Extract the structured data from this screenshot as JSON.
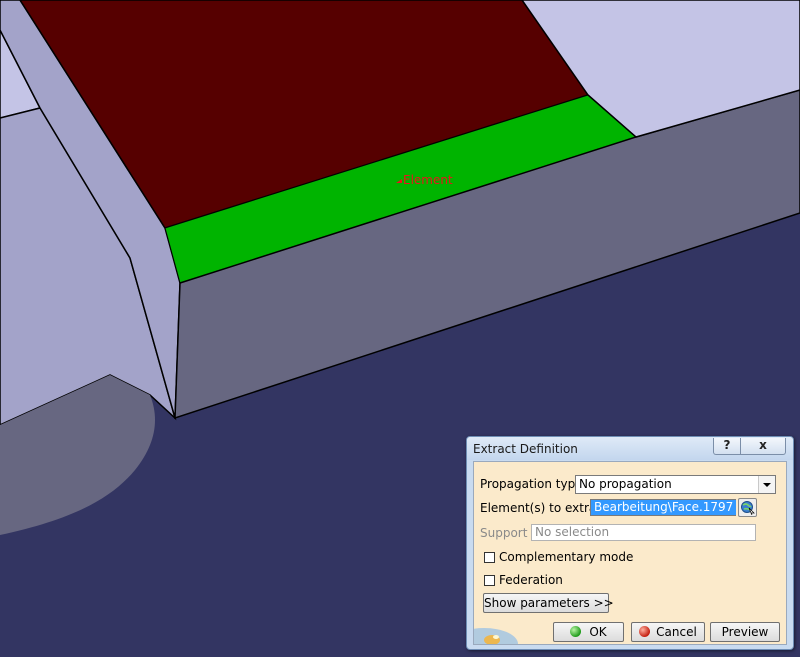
{
  "viewport": {
    "annotation_label": "Element",
    "colors": {
      "background": "#333562",
      "part_face_light": "#c4c4e6",
      "part_face_mid": "#a3a3c9",
      "part_face_dark": "#676781",
      "top_face": "#560000",
      "selected_face": "#00b400",
      "edge": "#000000"
    }
  },
  "dialog": {
    "title": "Extract Definition",
    "help_label": "?",
    "close_label": "x",
    "propagation_type_label": "Propagation type:",
    "propagation_type_value": "No propagation",
    "elements_to_extract_label": "Element(s) to extract",
    "elements_to_extract_value": "Bearbeitung\\Face.1797",
    "support_label": "Support :",
    "support_value": "No selection",
    "complementary_mode_label": "Complementary mode",
    "complementary_mode_checked": false,
    "federation_label": "Federation",
    "federation_checked": false,
    "show_parameters_label": "Show parameters >>",
    "ok_label": "OK",
    "cancel_label": "Cancel",
    "preview_label": "Preview",
    "icons": {
      "extract_selector": "globe-cursor-icon",
      "ok": "green-dot-icon",
      "cancel": "red-dot-icon"
    },
    "colors": {
      "frame": "#c9dbf0",
      "panel": "#fbeacb",
      "selection": "#3399ff"
    }
  }
}
